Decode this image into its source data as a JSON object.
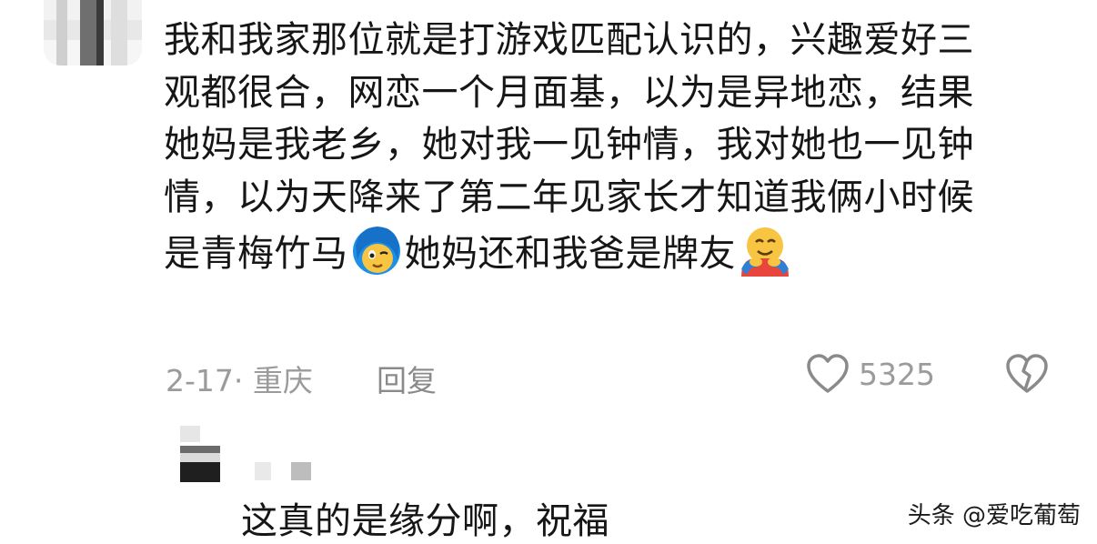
{
  "comment": {
    "lines": [
      "我和我家那位就是打游戏匹配认识的，兴趣爱好三",
      "观都很合，网恋一个月面基，以为是异地恋，结果",
      "她妈是我老乡，她对我一见钟情，我对她也一见钟",
      "情，以为天降来了第二年见家长才知道我俩小时候"
    ],
    "last_line_part1": "是青梅竹马",
    "emoji1": "blushing-face-emoji",
    "last_line_part2": "她妈还和我爸是牌友",
    "emoji2": "hugging-face-emoji",
    "meta": {
      "date_location": "2-17· 重庆",
      "reply_label": "回复",
      "like_count": "5325"
    }
  },
  "reply": {
    "text": "这真的是缘分啊，祝福"
  },
  "watermark": "头条 @爱吃葡萄",
  "colors": {
    "text": "#161616",
    "meta": "#9b9b9b",
    "emoji_blue": "#1e8fe6",
    "emoji_yellow": "#f7c542",
    "emoji_red": "#e8453c"
  }
}
